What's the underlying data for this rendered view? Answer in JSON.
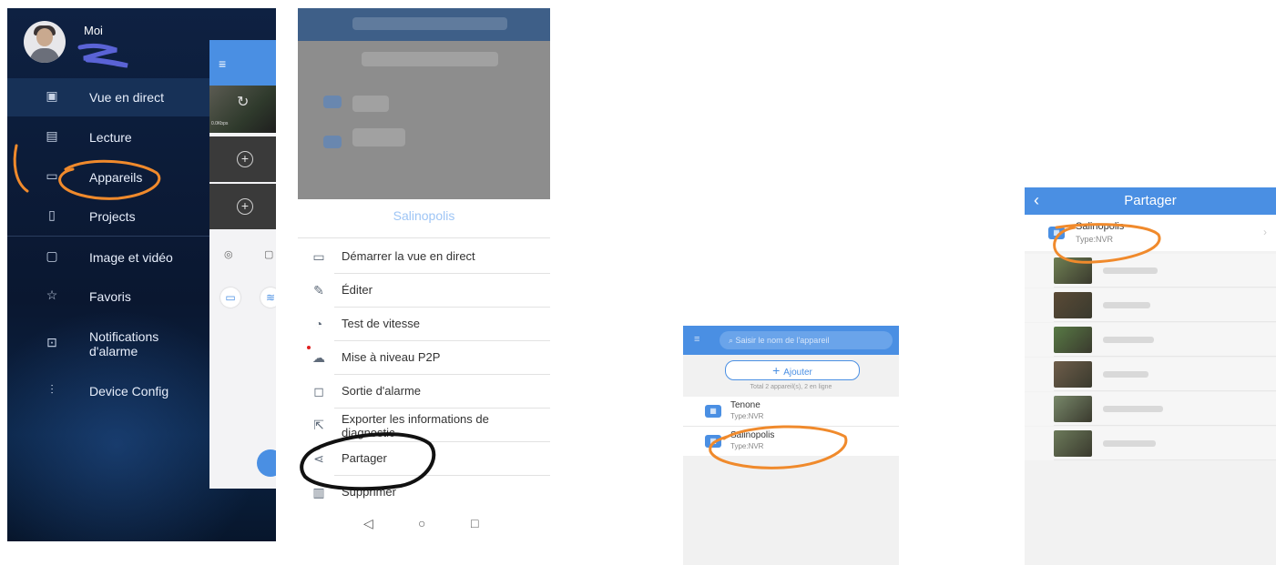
{
  "panel1": {
    "user_name": "Moi",
    "menu_items": [
      {
        "label": "Vue en direct",
        "icon": "live-view-icon",
        "active": true
      },
      {
        "label": "Lecture",
        "icon": "film-icon"
      },
      {
        "label": "Appareils",
        "icon": "device-icon"
      },
      {
        "label": "Projects",
        "icon": "document-icon"
      },
      {
        "label": "Image et vidéo",
        "icon": "folder-icon"
      },
      {
        "label": "Favoris",
        "icon": "star-icon"
      },
      {
        "label": "Notifications d'alarme",
        "icon": "alarm-icon"
      },
      {
        "label": "Device Config",
        "icon": "sliders-icon"
      }
    ],
    "preview_text": "0.0Kbps"
  },
  "panel2": {
    "device_title": "Salinopolis",
    "actions": [
      {
        "label": "Démarrer la vue en direct",
        "icon": "monitor-icon"
      },
      {
        "label": "Éditer",
        "icon": "edit-icon"
      },
      {
        "label": "Test de vitesse",
        "icon": "speed-icon"
      },
      {
        "label": "Mise à niveau P2P",
        "icon": "upload-cloud-icon"
      },
      {
        "label": "Sortie d'alarme",
        "icon": "bell-icon"
      },
      {
        "label": "Exporter les informations de diagnostic",
        "icon": "export-icon"
      },
      {
        "label": "Partager",
        "icon": "share-icon"
      },
      {
        "label": "Supprimer",
        "icon": "trash-icon"
      }
    ]
  },
  "panel3": {
    "search_placeholder": "Saisir le nom de l'appareil",
    "add_label": "Ajouter",
    "total_text": "Total 2 appareil(s), 2 en ligne",
    "devices": [
      {
        "name": "Tenone",
        "type": "Type:NVR"
      },
      {
        "name": "Salinopolis",
        "type": "Type:NVR"
      }
    ]
  },
  "panel4": {
    "title": "Partager",
    "device": {
      "name": "Salinopolis",
      "type": "Type:NVR"
    },
    "cameras": [
      {
        "thumb_color": "#6f7f53"
      },
      {
        "thumb_color": "#5a4a36"
      },
      {
        "thumb_color": "#587a45"
      },
      {
        "thumb_color": "#6e5d4a"
      },
      {
        "thumb_color": "#78886a"
      },
      {
        "thumb_color": "#6c7a5a"
      }
    ]
  },
  "colors": {
    "accent": "#4a8fe3",
    "annotation_orange": "#f08a2c",
    "annotation_black": "#111111",
    "annotation_blue": "#5a63d6"
  }
}
